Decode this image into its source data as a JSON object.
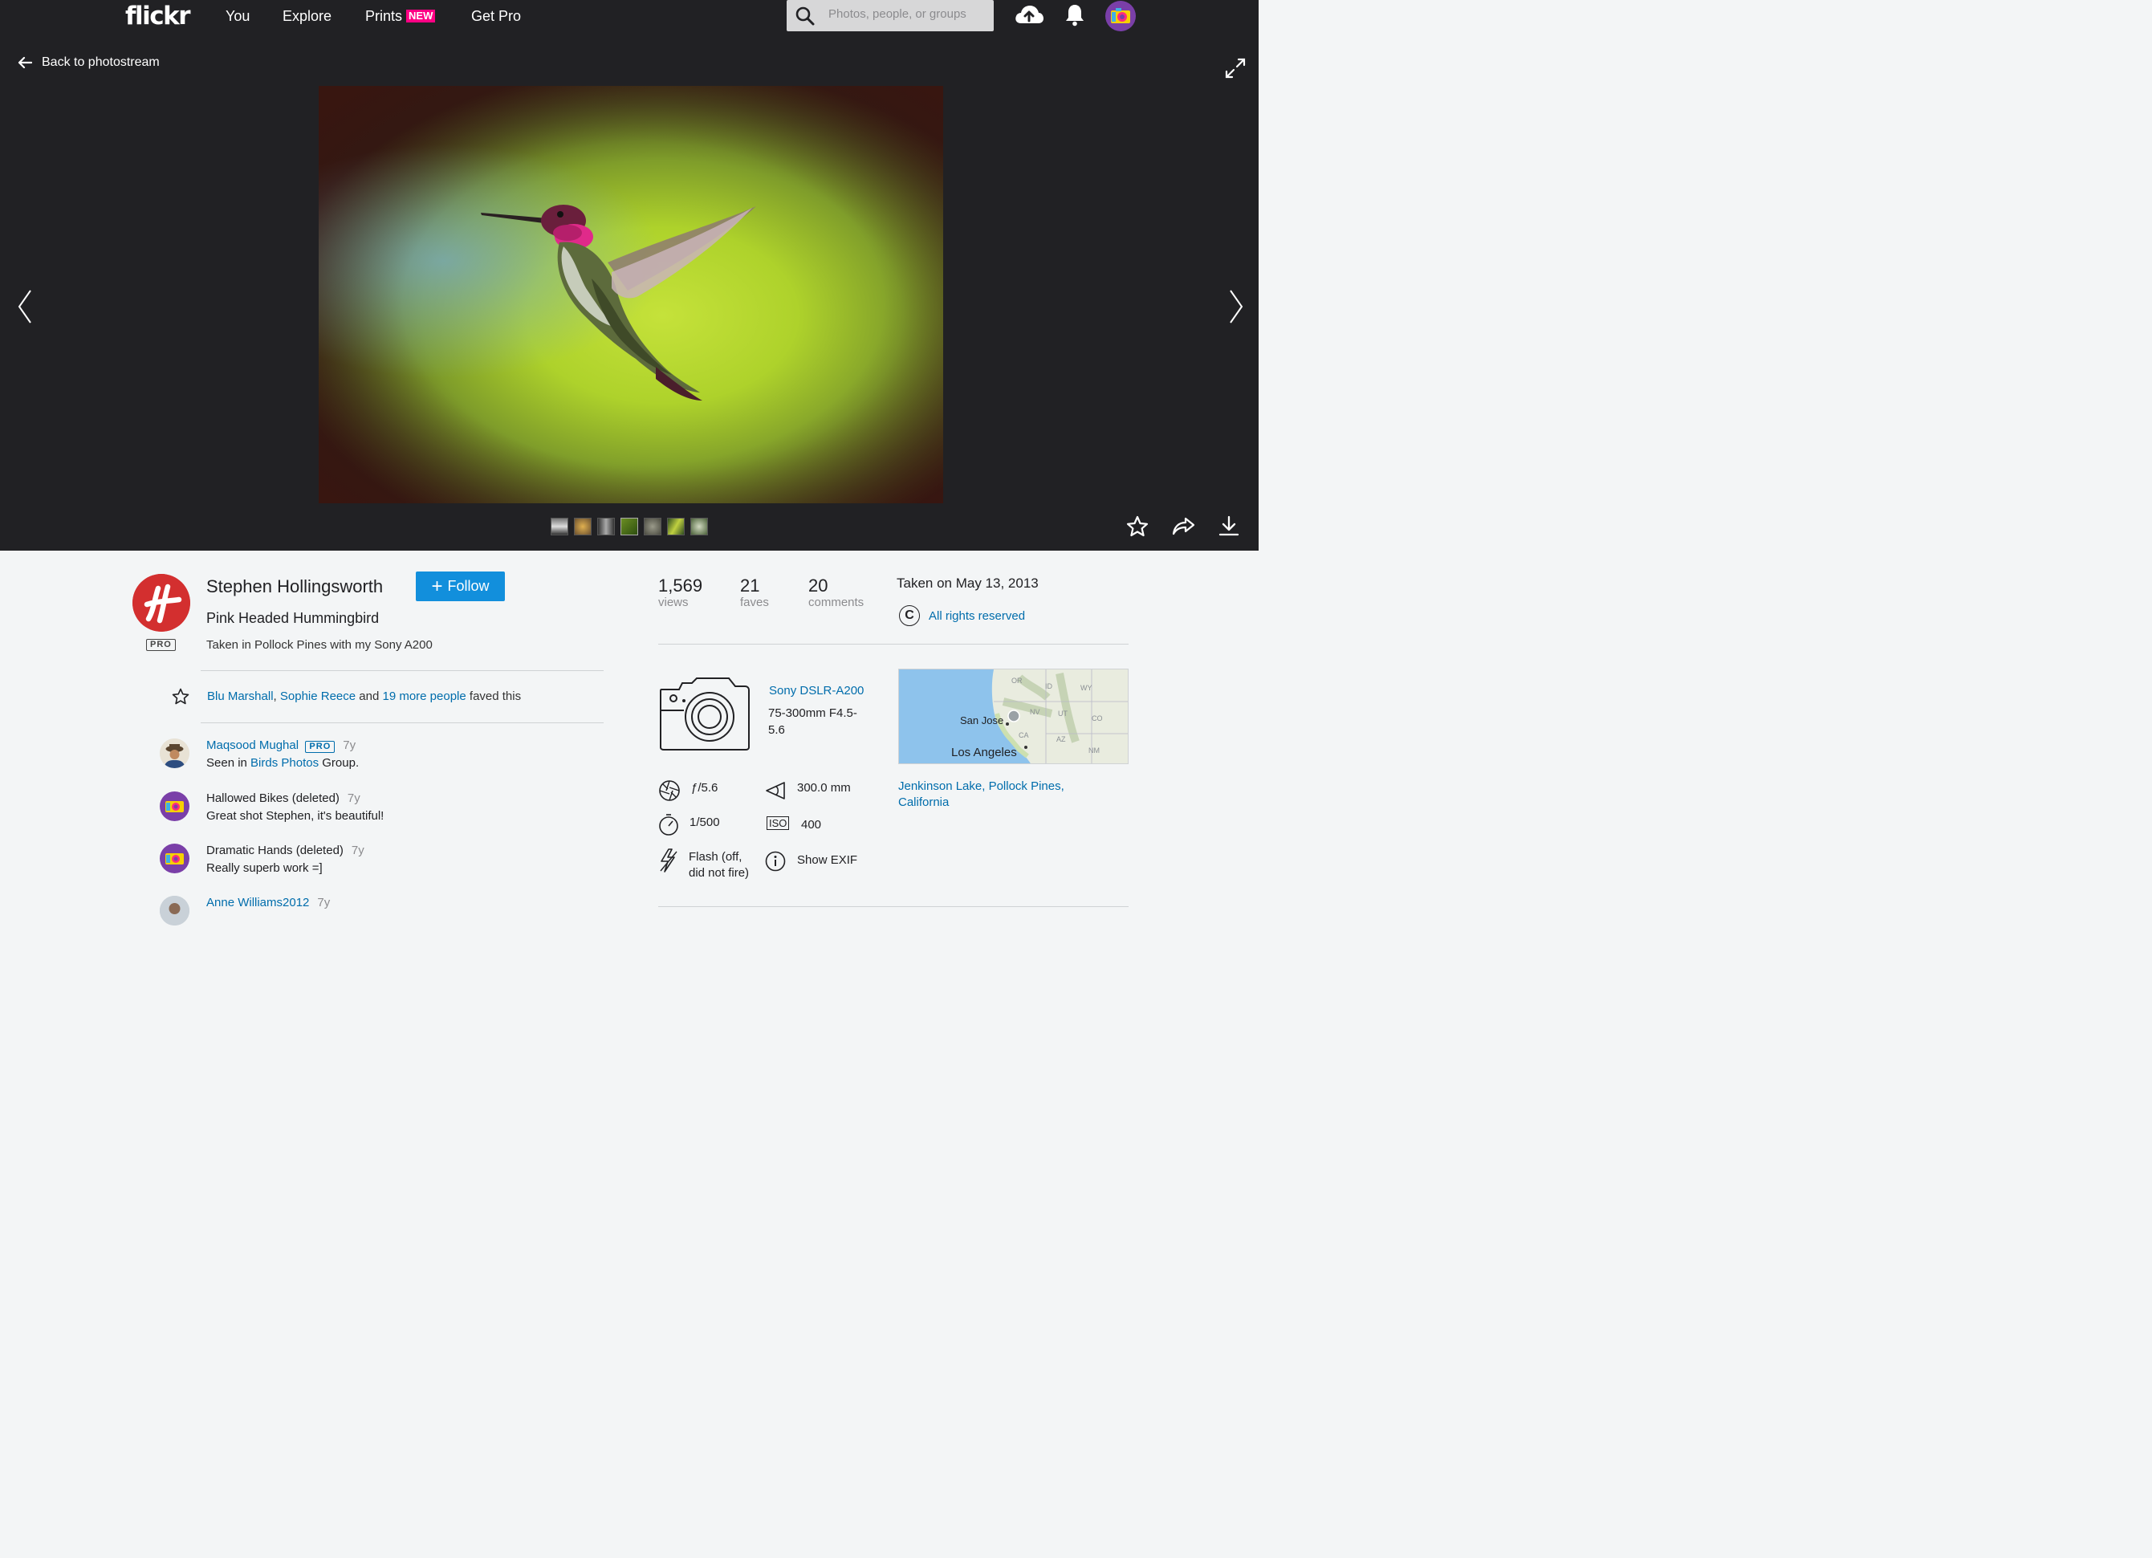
{
  "nav": {
    "logo": "flickr",
    "you": "You",
    "explore": "Explore",
    "prints": "Prints",
    "prints_badge": "NEW",
    "get_pro": "Get Pro",
    "search_placeholder": "Photos, people, or groups",
    "icons": [
      "search-icon",
      "upload-cloud-icon",
      "notification-bell-icon",
      "user-avatar"
    ]
  },
  "stage": {
    "back_label": "Back to photostream",
    "thumb_count": 7,
    "icons": [
      "back-arrow-icon",
      "expand-icon",
      "prev-arrow-icon",
      "next-arrow-icon",
      "fave-star-icon",
      "share-icon",
      "download-icon"
    ]
  },
  "owner": {
    "name": "Stephen Hollingsworth",
    "pro": "PRO",
    "follow_label": "Follow"
  },
  "photo": {
    "title": "Pink Headed Hummingbird",
    "description": "Taken in Pollock Pines with my Sony A200"
  },
  "faves": {
    "person1": "Blu Marshall",
    "sep": ",",
    "person2": "Sophie Reece",
    "and": "and",
    "more": "19 more people",
    "suffix": "faved this"
  },
  "comments": [
    {
      "name": "Maqsood Mughal",
      "pro": "PRO",
      "time": "7y",
      "text_prefix": "Seen in",
      "link": "Birds Photos",
      "text_suffix": "Group."
    },
    {
      "name": "Hallowed Bikes (deleted)",
      "time": "7y",
      "text": "Great shot Stephen, it's beautiful!"
    },
    {
      "name": "Dramatic Hands (deleted)",
      "time": "7y",
      "text": "Really superb work =]"
    },
    {
      "name": "Anne Williams2012",
      "time": "7y"
    }
  ],
  "stats": {
    "views": "1,569",
    "views_label": "views",
    "faves": "21",
    "faves_label": "faves",
    "comments": "20",
    "comments_label": "comments"
  },
  "taken_on": "Taken on May 13, 2013",
  "license": "All rights reserved",
  "camera": {
    "model": "Sony DSLR-A200",
    "lens": "75-300mm F4.5-5.6",
    "aperture": "ƒ/5.6",
    "focal_length": "300.0 mm",
    "shutter": "1/500",
    "iso_label": "ISO",
    "iso": "400",
    "flash": "Flash (off, did not fire)",
    "show_exif": "Show EXIF"
  },
  "map": {
    "labels": [
      "OR",
      "ID",
      "WY",
      "NV",
      "UT",
      "CO",
      "CA",
      "AZ",
      "NM"
    ],
    "city1": "San Jose",
    "city2": "Los Angeles"
  },
  "location": "Jenkinson Lake, Pollock Pines, California",
  "colors": {
    "nav_bg": "#212124",
    "stage_bg": "#212124",
    "link": "#006dac",
    "follow_btn": "#128fdc",
    "new_badge": "#ff0084",
    "page_bg": "#f3f5f6"
  }
}
